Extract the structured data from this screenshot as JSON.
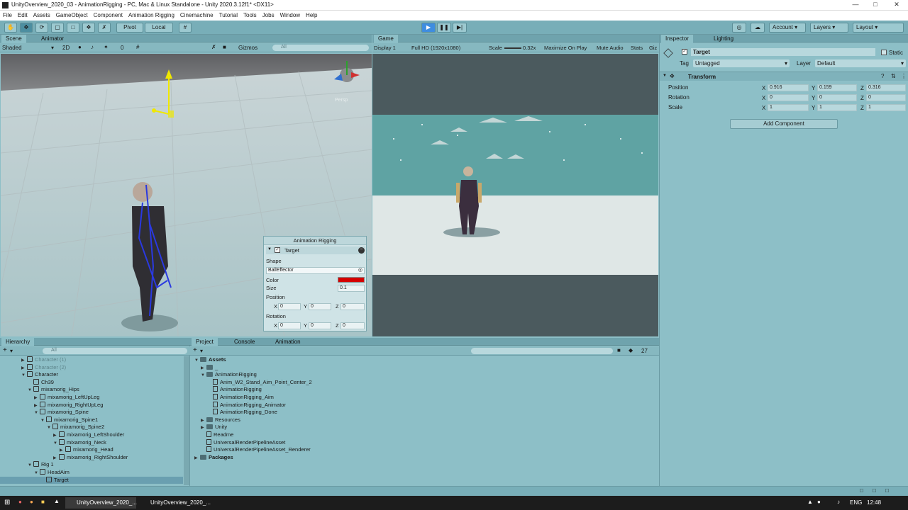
{
  "window": {
    "title": "UnityOverview_2020_03 - AnimationRigging - PC, Mac & Linux Standalone - Unity 2020.3.12f1* <DX11>"
  },
  "menu": [
    "File",
    "Edit",
    "Assets",
    "GameObject",
    "Component",
    "Animation Rigging",
    "Cinemachine",
    "Tutorial",
    "Tools",
    "Jobs",
    "Window",
    "Help"
  ],
  "toolbar": {
    "pivot": "Pivot",
    "local": "Local",
    "account": "Account",
    "layers": "Layers",
    "layout": "Layout"
  },
  "scene": {
    "tabs": [
      "Scene",
      "Animator"
    ],
    "shading": "Shaded",
    "mode_2d": "2D",
    "hidden_count": "0",
    "gizmos": "Gizmos",
    "search_placeholder": "All",
    "persp": "Persp"
  },
  "game": {
    "tab": "Game",
    "display": "Display 1",
    "resolution": "Full HD (1920x1080)",
    "scale_label": "Scale",
    "scale_value": "0.32x",
    "maximize": "Maximize On Play",
    "mute": "Mute Audio",
    "stats": "Stats",
    "gizmos": "Giz"
  },
  "rig_overlay": {
    "title": "Animation Rigging",
    "target": "Target",
    "shape_label": "Shape",
    "shape_value": "BallEffector",
    "color_label": "Color",
    "color_value": "#d40000",
    "size_label": "Size",
    "size_value": "0.1",
    "position_label": "Position",
    "rotation_label": "Rotation",
    "x": "X",
    "y": "Y",
    "z": "Z",
    "pos": [
      "0",
      "0",
      "0"
    ],
    "rot": [
      "0",
      "0",
      "0"
    ]
  },
  "inspector": {
    "tabs": [
      "Inspector",
      "Lighting"
    ],
    "object_name": "Target",
    "static": "Static",
    "tag_label": "Tag",
    "tag_value": "Untagged",
    "layer_label": "Layer",
    "layer_value": "Default",
    "transform": "Transform",
    "position_label": "Position",
    "rotation_label": "Rotation",
    "scale_label": "Scale",
    "position": [
      "0.916",
      "0.159",
      "0.316"
    ],
    "rotation": [
      "0",
      "0",
      "0"
    ],
    "scale": [
      "1",
      "1",
      "1"
    ],
    "x": "X",
    "y": "Y",
    "z": "Z",
    "add_component": "Add Component"
  },
  "hierarchy": {
    "tab": "Hierarchy",
    "search_placeholder": "All",
    "items": [
      {
        "label": "Character (1)",
        "depth": 0,
        "dim": true,
        "arrow": "▶"
      },
      {
        "label": "Character (2)",
        "depth": 0,
        "dim": true,
        "arrow": "▶"
      },
      {
        "label": "Character",
        "depth": 0,
        "arrow": "▼"
      },
      {
        "label": "Ch39",
        "depth": 1,
        "arrow": ""
      },
      {
        "label": "mixamorig_Hips",
        "depth": 1,
        "arrow": "▼"
      },
      {
        "label": "mixamorig_LeftUpLeg",
        "depth": 2,
        "arrow": "▶"
      },
      {
        "label": "mixamorig_RightUpLeg",
        "depth": 2,
        "arrow": "▶"
      },
      {
        "label": "mixamorig_Spine",
        "depth": 2,
        "arrow": "▼"
      },
      {
        "label": "mixamorig_Spine1",
        "depth": 3,
        "arrow": "▼"
      },
      {
        "label": "mixamorig_Spine2",
        "depth": 4,
        "arrow": "▼"
      },
      {
        "label": "mixamorig_LeftShoulder",
        "depth": 5,
        "arrow": "▶"
      },
      {
        "label": "mixamorig_Neck",
        "depth": 5,
        "arrow": "▼"
      },
      {
        "label": "mixamorig_Head",
        "depth": 6,
        "arrow": "▶"
      },
      {
        "label": "mixamorig_RightShoulder",
        "depth": 5,
        "arrow": "▶"
      },
      {
        "label": "Rig 1",
        "depth": 1,
        "arrow": "▼"
      },
      {
        "label": "HeadAim",
        "depth": 2,
        "arrow": "▼"
      },
      {
        "label": "Target",
        "depth": 3,
        "arrow": "",
        "selected": true
      }
    ]
  },
  "project": {
    "tabs": [
      "Project",
      "Console",
      "Animation"
    ],
    "hidden_count": "27",
    "items": [
      {
        "label": "Assets",
        "depth": 0,
        "arrow": "▼",
        "icon": "folder",
        "bold": true
      },
      {
        "label": "_",
        "depth": 1,
        "arrow": "▶",
        "icon": "folder"
      },
      {
        "label": "AnimationRigging",
        "depth": 1,
        "arrow": "▼",
        "icon": "folder"
      },
      {
        "label": "Anim_W2_Stand_Aim_Point_Center_2",
        "depth": 2,
        "arrow": "",
        "icon": "file"
      },
      {
        "label": "AnimationRigging",
        "depth": 2,
        "arrow": "",
        "icon": "file"
      },
      {
        "label": "AnimationRigging_Aim",
        "depth": 2,
        "arrow": "",
        "icon": "file"
      },
      {
        "label": "AnimationRigging_Animator",
        "depth": 2,
        "arrow": "",
        "icon": "file"
      },
      {
        "label": "AnimationRigging_Done",
        "depth": 2,
        "arrow": "",
        "icon": "file"
      },
      {
        "label": "Resources",
        "depth": 1,
        "arrow": "▶",
        "icon": "folder"
      },
      {
        "label": "Unity",
        "depth": 1,
        "arrow": "▶",
        "icon": "folder"
      },
      {
        "label": "Readme",
        "depth": 1,
        "arrow": "",
        "icon": "file"
      },
      {
        "label": "UniversalRenderPipelineAsset",
        "depth": 1,
        "arrow": "",
        "icon": "file"
      },
      {
        "label": "UniversalRenderPipelineAsset_Renderer",
        "depth": 1,
        "arrow": "",
        "icon": "file"
      },
      {
        "label": "Packages",
        "depth": 0,
        "arrow": "▶",
        "icon": "folder",
        "bold": true
      }
    ]
  },
  "taskbar": {
    "tasks": [
      "UnityOverview_2020_...",
      "UnityOverview_2020_..."
    ],
    "lang": "ENG",
    "time": "12:48"
  }
}
